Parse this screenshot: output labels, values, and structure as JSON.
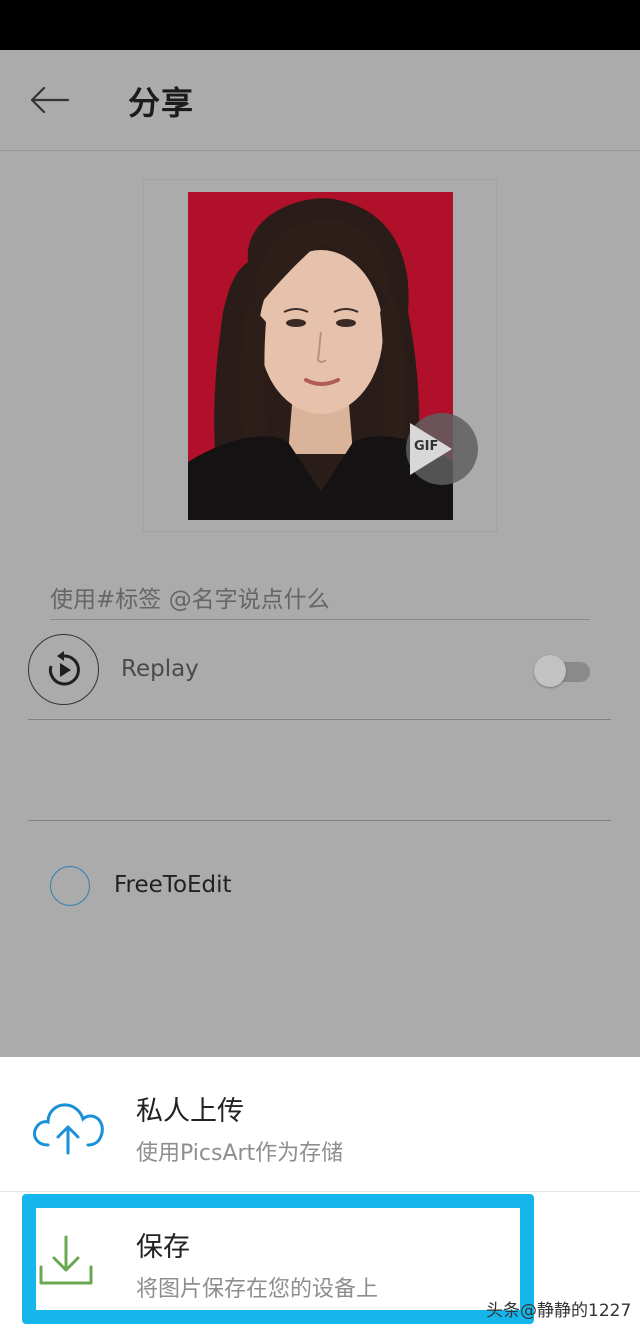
{
  "header": {
    "title": "分享"
  },
  "caption": {
    "placeholder": "使用#标签 @名字说点什么"
  },
  "preview": {
    "badge": "GIF"
  },
  "replay": {
    "label": "Replay",
    "enabled": false
  },
  "free_to_edit": {
    "label": "FreeToEdit",
    "checked": false
  },
  "sheet": {
    "items": [
      {
        "title": "私人上传",
        "subtitle": "使用PicsArt作为存储",
        "icon": "cloud-upload-icon"
      },
      {
        "title": "保存",
        "subtitle": "将图片保存在您的设备上",
        "icon": "download-icon"
      }
    ]
  },
  "watermark": "头条@静静的1227",
  "colors": {
    "photo_bg": "#b0102a",
    "accent_blue": "#1a90d8",
    "accent_green": "#6aa84f",
    "highlight": "#14b6ec"
  }
}
